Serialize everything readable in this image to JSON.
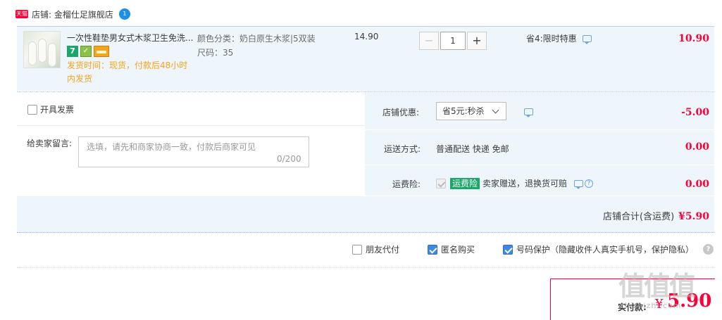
{
  "shop": {
    "badge": "天猫",
    "name": "店铺: 金榴仕足旗舰店",
    "chat_badge": "1"
  },
  "item": {
    "title": "一次性鞋垫男女式木浆卫生免洗...",
    "ship_time": "发货时间：现货，付款后48小时内发货",
    "sku_color": "颜色分类：奶白原生木浆|5双装",
    "sku_size": "尺码：35",
    "unit_price": "14.90",
    "quantity": "1",
    "minus": "−",
    "plus": "+",
    "promo": "省4:限时特惠",
    "total": "10.90",
    "badge_7": "7"
  },
  "options": {
    "invoice_label": "开具发票",
    "message_label": "给卖家留言:",
    "message_placeholder": "选填，请先和商家协商一致，付款后商家可见",
    "message_count": "0/200",
    "coupon_label": "店铺优惠:",
    "coupon_value": "省5元:秒杀",
    "coupon_amount": "-5.00",
    "shipping_label": "运送方式:",
    "shipping_value": "普通配送 快递 免邮",
    "shipping_amount": "0.00",
    "insurance_label": "运费险:",
    "insurance_tag": "运费险",
    "insurance_text": "卖家赠送，退换货可赔",
    "insurance_amount": "0.00"
  },
  "subtotal": {
    "label": "店铺合计(含运费)",
    "value": "¥5.90"
  },
  "extras": {
    "friend_pay": "朋友代付",
    "anonymous": "匿名购买",
    "number_protect": "号码保护（隐藏收件人真实手机号，保护隐私）",
    "help": "?"
  },
  "pay": {
    "label": "实付款:",
    "symbol": "¥",
    "amount": "5.90"
  },
  "watermark": {
    "logo": "值值值",
    "site": "zhizhizhi.com"
  },
  "colors": {
    "accent_red": "#ff0036",
    "panel_blue": "#eef5fb",
    "check_blue": "#3d8ae0",
    "ship_orange": "#f7a31c"
  }
}
